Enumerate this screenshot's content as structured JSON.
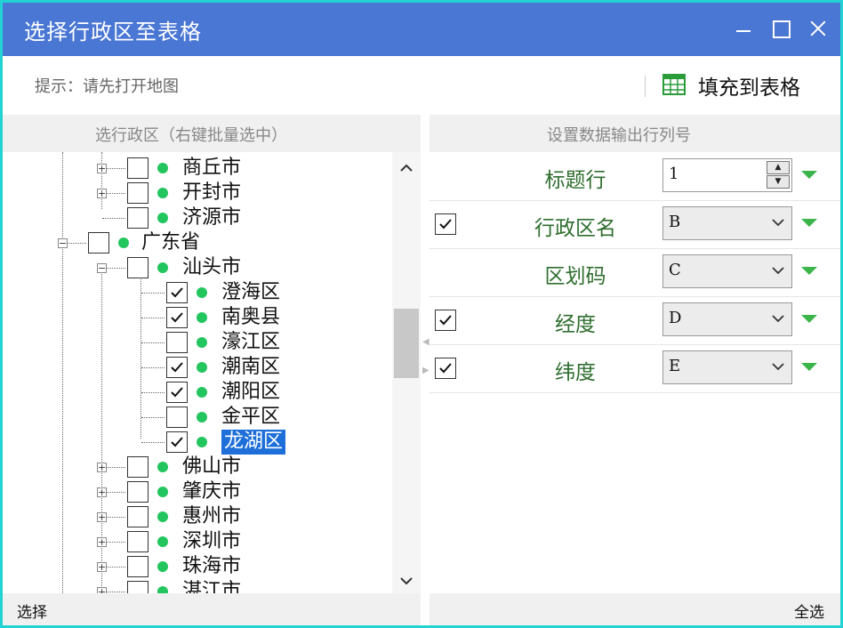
{
  "window": {
    "title": "选择行政区至表格",
    "controls": {
      "minimize_icon": "minimize-icon",
      "maximize_icon": "maximize-icon",
      "close_icon": "close-icon"
    }
  },
  "toolbar": {
    "hint": "提示：请先打开地图",
    "fill_button_label": "填充到表格",
    "fill_button_icon": "table-icon"
  },
  "left_panel": {
    "header": "选行政区（右键批量选中）"
  },
  "tree": {
    "nodes": [
      {
        "label": "商丘市",
        "checked": false,
        "expander": "+"
      },
      {
        "label": "开封市",
        "checked": false,
        "expander": "+"
      },
      {
        "label": "济源市",
        "checked": false,
        "expander": ""
      },
      {
        "label": "广东省",
        "checked": false,
        "expander": "-"
      },
      {
        "label": "汕头市",
        "checked": false,
        "expander": "-"
      },
      {
        "label": "澄海区",
        "checked": true,
        "expander": ""
      },
      {
        "label": "南奥县",
        "checked": true,
        "expander": ""
      },
      {
        "label": "濠江区",
        "checked": false,
        "expander": ""
      },
      {
        "label": "潮南区",
        "checked": true,
        "expander": ""
      },
      {
        "label": "潮阳区",
        "checked": true,
        "expander": ""
      },
      {
        "label": "金平区",
        "checked": false,
        "expander": ""
      },
      {
        "label": "龙湖区",
        "checked": true,
        "expander": "",
        "selected": true
      },
      {
        "label": "佛山市",
        "checked": false,
        "expander": "+"
      },
      {
        "label": "肇庆市",
        "checked": false,
        "expander": "+"
      },
      {
        "label": "惠州市",
        "checked": false,
        "expander": "+"
      },
      {
        "label": "深圳市",
        "checked": false,
        "expander": "+"
      },
      {
        "label": "珠海市",
        "checked": false,
        "expander": "+"
      },
      {
        "label": "湛江市",
        "checked": false,
        "expander": "+"
      }
    ],
    "status_dot_color": "#22c55e",
    "selection_color": "#1e6fd9"
  },
  "right_panel": {
    "header": "设置数据输出行列号",
    "rows": [
      {
        "label": "标题行",
        "has_checkbox": false,
        "checked": false,
        "value": "1",
        "control": "spinner"
      },
      {
        "label": "行政区名",
        "has_checkbox": true,
        "checked": true,
        "value": "B",
        "control": "dropdown"
      },
      {
        "label": "区划码",
        "has_checkbox": false,
        "checked": false,
        "value": "C",
        "control": "dropdown"
      },
      {
        "label": "经度",
        "has_checkbox": true,
        "checked": true,
        "value": "D",
        "control": "dropdown"
      },
      {
        "label": "纬度",
        "has_checkbox": true,
        "checked": true,
        "value": "E",
        "control": "dropdown"
      }
    ]
  },
  "status": {
    "left": "选择",
    "right": "全选"
  },
  "colors": {
    "titlebar": "#4a76d4",
    "label_green": "#2f6e2f",
    "triangle_green": "#3bb54a",
    "frame": "#22d3d3"
  }
}
